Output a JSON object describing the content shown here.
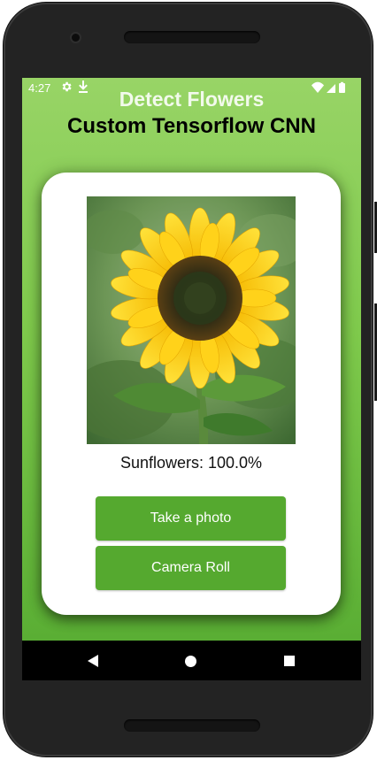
{
  "status_bar": {
    "time": "4:27",
    "icons": [
      "gear-icon",
      "download-icon",
      "wifi-icon",
      "signal-icon",
      "battery-icon"
    ]
  },
  "app": {
    "overlay_title": "Detect Flowers",
    "title": "Custom Tensorflow CNN",
    "image_subject": "sunflower",
    "result": "Sunflowers: 100.0%",
    "buttons": {
      "take_photo": "Take a photo",
      "camera_roll": "Camera Roll"
    }
  },
  "nav_bar": {
    "icons": [
      "back-icon",
      "home-icon",
      "recents-icon"
    ]
  },
  "colors": {
    "background_top": "#98d466",
    "background_bottom": "#5aae34",
    "button": "#55a92f",
    "card": "#ffffff"
  }
}
